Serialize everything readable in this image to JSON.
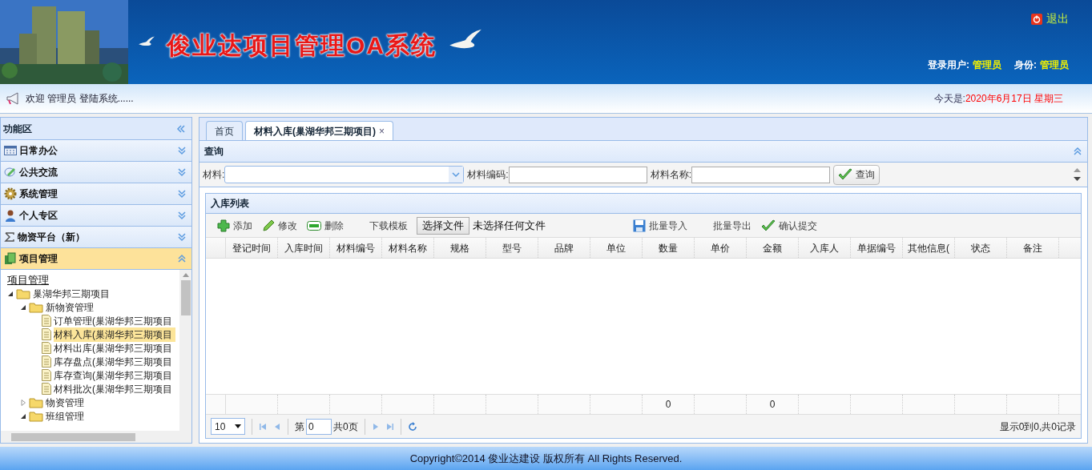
{
  "header": {
    "title": "俊业达项目管理OA系统",
    "logout": "退出",
    "user_label": "登录用户:",
    "user": "管理员",
    "role_label": "身份:",
    "role": "管理员"
  },
  "welcome": {
    "text": "欢迎 管理员 登陆系统......",
    "date_label": "今天是:",
    "date": "2020年6月17日 星期三"
  },
  "sidebar": {
    "title": "功能区",
    "sections": [
      {
        "label": "日常办公",
        "kind": "calendar",
        "expanded": false
      },
      {
        "label": "公共交流",
        "kind": "chat",
        "expanded": false
      },
      {
        "label": "系统管理",
        "kind": "gear",
        "expanded": false
      },
      {
        "label": "个人专区",
        "kind": "person",
        "expanded": false
      },
      {
        "label": "物资平台（新）",
        "kind": "sigma",
        "expanded": false
      },
      {
        "label": "项目管理",
        "kind": "books",
        "expanded": true
      }
    ],
    "tree_title": "项目管理",
    "tree": [
      {
        "label": "巢湖华邦三期项目",
        "kind": "folder",
        "expanded": true,
        "selected": false,
        "children": [
          {
            "label": "新物资管理",
            "kind": "folder",
            "expanded": true,
            "selected": false,
            "children": [
              {
                "label": "订单管理(巢湖华邦三期项目",
                "kind": "file",
                "selected": false
              },
              {
                "label": "材料入库(巢湖华邦三期项目",
                "kind": "file",
                "selected": true
              },
              {
                "label": "材料出库(巢湖华邦三期项目",
                "kind": "file",
                "selected": false
              },
              {
                "label": "库存盘点(巢湖华邦三期项目",
                "kind": "file",
                "selected": false
              },
              {
                "label": "库存查询(巢湖华邦三期项目",
                "kind": "file",
                "selected": false
              },
              {
                "label": "材料批次(巢湖华邦三期项目",
                "kind": "file",
                "selected": false
              }
            ]
          },
          {
            "label": "物资管理",
            "kind": "folder",
            "expanded": false,
            "selected": false
          },
          {
            "label": "班组管理",
            "kind": "folder",
            "expanded": true,
            "selected": false
          }
        ]
      }
    ]
  },
  "tabs": [
    {
      "label": "首页",
      "selected": false,
      "closable": false
    },
    {
      "label": "材料入库(巢湖华邦三期项目)",
      "selected": true,
      "closable": true
    }
  ],
  "close_glyph": "×",
  "query": {
    "title": "查询",
    "fields": [
      {
        "label": "材料:",
        "kind": "select"
      },
      {
        "label": "材料编码:",
        "kind": "text"
      },
      {
        "label": "材料名称:",
        "kind": "text"
      }
    ],
    "button": "查询"
  },
  "list": {
    "title": "入库列表",
    "toolbar": [
      {
        "label": "添加",
        "kind": "add"
      },
      {
        "label": "修改",
        "kind": "edit"
      },
      {
        "label": "删除",
        "kind": "delete"
      },
      {
        "label": "下载模板",
        "kind": "plain"
      },
      {
        "label": "选择文件",
        "kind": "file"
      },
      {
        "label": "批量导入",
        "kind": "save"
      },
      {
        "label": "批量导出",
        "kind": "plain"
      },
      {
        "label": "确认提交",
        "kind": "check"
      }
    ],
    "file_status": "未选择任何文件",
    "columns": [
      {
        "label": "登记时间"
      },
      {
        "label": "入库时间"
      },
      {
        "label": "材料编号"
      },
      {
        "label": "材料名称"
      },
      {
        "label": "规格"
      },
      {
        "label": "型号"
      },
      {
        "label": "品牌"
      },
      {
        "label": "单位"
      },
      {
        "label": "数量",
        "footer": "0"
      },
      {
        "label": "单价"
      },
      {
        "label": "金额",
        "footer": "0"
      },
      {
        "label": "入库人"
      },
      {
        "label": "单据编号"
      },
      {
        "label": "其他信息("
      },
      {
        "label": "状态"
      },
      {
        "label": "备注"
      }
    ],
    "pager": {
      "page_size": "10",
      "page_label": "第",
      "page": "0",
      "total_label": "共0页",
      "summary": "显示0到0,共0记录"
    }
  },
  "footer": "Copyright©2014 俊业达建设 版权所有 All Rights Reserved."
}
